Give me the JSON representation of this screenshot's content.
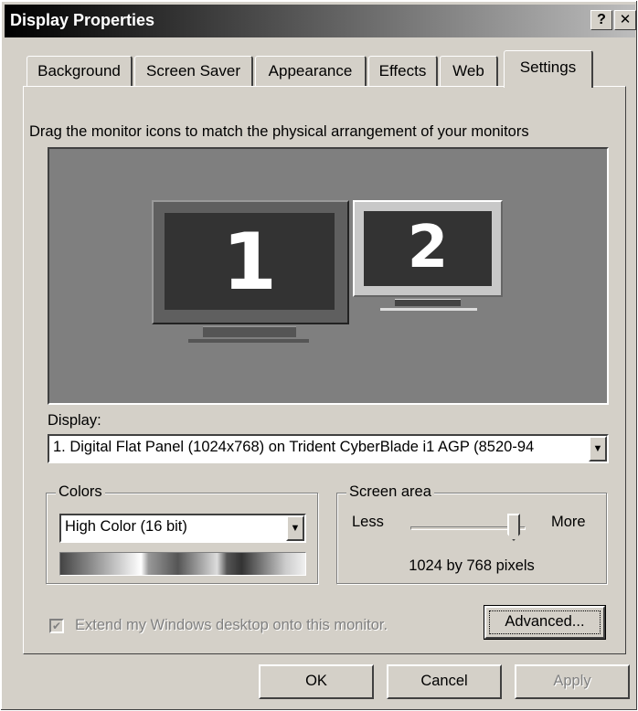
{
  "window": {
    "title": "Display Properties",
    "help_button": "?",
    "close_button": "✕"
  },
  "tabs": [
    {
      "label": "Background",
      "active": false
    },
    {
      "label": "Screen Saver",
      "active": false
    },
    {
      "label": "Appearance",
      "active": false
    },
    {
      "label": "Effects",
      "active": false
    },
    {
      "label": "Web",
      "active": false
    },
    {
      "label": "Settings",
      "active": true
    }
  ],
  "settings": {
    "instruction": "Drag the monitor icons to match the physical arrangement of your monitors",
    "monitors": [
      {
        "number": "1",
        "selected": true
      },
      {
        "number": "2",
        "selected": false
      }
    ],
    "display_label": "Display:",
    "display_value": "1. Digital Flat Panel (1024x768) on Trident CyberBlade i1 AGP (8520-94",
    "colors": {
      "group_title": "Colors",
      "value": "High Color (16 bit)"
    },
    "screen_area": {
      "group_title": "Screen area",
      "less_label": "Less",
      "more_label": "More",
      "slider_position": 1.0,
      "resolution_text": "1024 by 768 pixels"
    },
    "extend_checkbox": {
      "label": "Extend my Windows desktop onto this monitor.",
      "checked": true,
      "enabled": false
    },
    "advanced_button": "Advanced..."
  },
  "buttons": {
    "ok": "OK",
    "cancel": "Cancel",
    "apply": "Apply"
  },
  "icons": {
    "checkmark": "checkmark-icon",
    "dropdown": "chevron-down-icon"
  }
}
